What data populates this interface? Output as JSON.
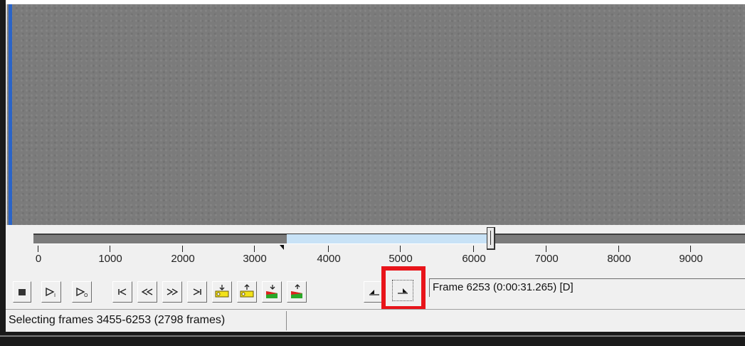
{
  "timeline": {
    "ticks": [
      "0",
      "1000",
      "2000",
      "3000",
      "4000",
      "5000",
      "6000",
      "7000",
      "8000",
      "9000"
    ],
    "selection_start": 3455,
    "selection_end": 6253,
    "current_frame": 6253,
    "max_frame": 9750
  },
  "toolbar": {
    "buttons": [
      {
        "name": "stop-button",
        "icon": "stop-icon"
      },
      {
        "name": "play-input-button",
        "icon": "play-input-icon"
      },
      {
        "name": "play-output-button",
        "icon": "play-output-icon"
      },
      {
        "name": "go-to-start-button",
        "icon": "go-start-icon"
      },
      {
        "name": "step-backward-button",
        "icon": "step-back-icon"
      },
      {
        "name": "step-forward-button",
        "icon": "step-forward-icon"
      },
      {
        "name": "go-to-end-button",
        "icon": "go-end-icon"
      },
      {
        "name": "prev-keyframe-button",
        "icon": "key-prev-icon"
      },
      {
        "name": "next-keyframe-button",
        "icon": "key-next-icon"
      },
      {
        "name": "prev-scene-button",
        "icon": "scene-prev-icon"
      },
      {
        "name": "next-scene-button",
        "icon": "scene-next-icon"
      },
      {
        "name": "mark-in-button",
        "icon": "mark-in-icon"
      },
      {
        "name": "mark-out-button",
        "icon": "mark-out-icon"
      }
    ],
    "frame_info": "Frame 6253 (0:00:31.265) [D]"
  },
  "status": {
    "text": "Selecting frames 3455-6253 (2798 frames)"
  },
  "colors": {
    "highlight": "#e8141a",
    "selection": "#c8e2f6",
    "video_bg": "#7b7b7b"
  }
}
